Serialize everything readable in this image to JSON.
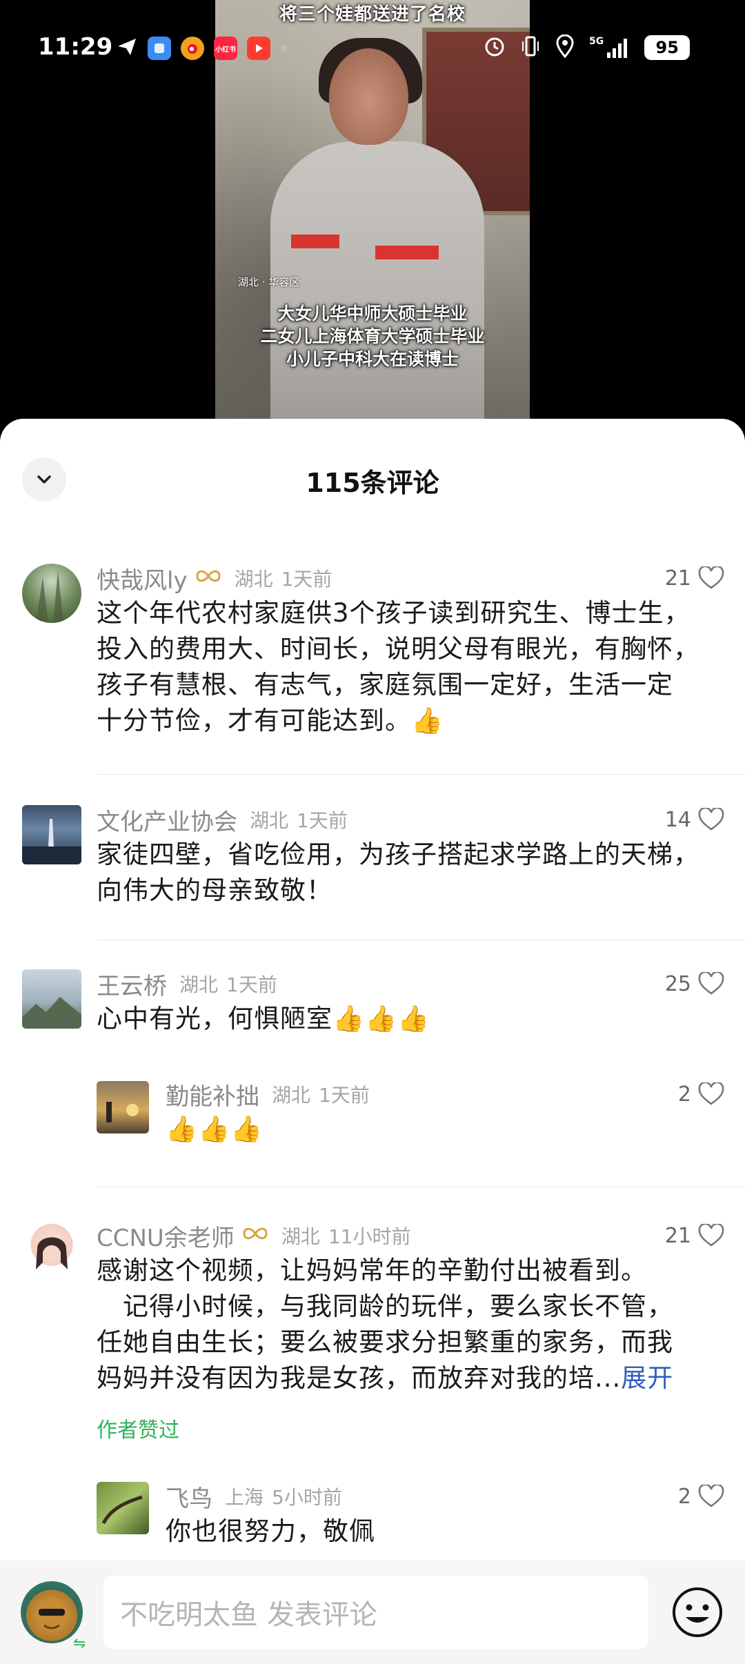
{
  "status_bar": {
    "time": "11:29",
    "left_icons": [
      "send-icon",
      "blue-app-icon",
      "weibo-icon",
      "xiaohongshu-icon",
      "video-app-icon",
      "dot-icon"
    ],
    "xhs_label": "小红书",
    "right_icons": [
      "alarm-icon",
      "vibrate-icon",
      "location-icon",
      "signal-5g-icon"
    ],
    "network": "5G",
    "battery": "95"
  },
  "video": {
    "title": "将三个娃都送进了名校",
    "location": "湖北 · 华容区",
    "subtitles": [
      "大女儿华中师大硕士毕业",
      "二女儿上海体育大学硕士毕业",
      "小儿子中科大在读博士"
    ]
  },
  "sheet": {
    "title": "115条评论"
  },
  "comments": [
    {
      "username": "快哉风ly",
      "badge": true,
      "location": "湖北",
      "time": "1天前",
      "likes": "21",
      "text_lines": [
        "这个年代农村家庭供3个孩子读到研究生、博士生，",
        "投入的费用大、时间长，说明父母有眼光，有胸怀，",
        "孩子有慧根、有志气，家庭氛围一定好，生活一定",
        "十分节俭，才有可能达到。👍"
      ]
    },
    {
      "username": "文化产业协会",
      "badge": false,
      "location": "湖北",
      "time": "1天前",
      "likes": "14",
      "text_lines": [
        "家徒四壁，省吃俭用，为孩子搭起求学路上的天梯，",
        "向伟大的母亲致敬！"
      ]
    },
    {
      "username": "王云桥",
      "badge": false,
      "location": "湖北",
      "time": "1天前",
      "likes": "25",
      "text_lines": [
        "心中有光，何惧陋室👍👍👍"
      ]
    },
    {
      "username": "勤能补拙",
      "badge": false,
      "location": "湖北",
      "time": "1天前",
      "likes": "2",
      "text_lines": [
        "👍👍👍"
      ]
    },
    {
      "username": "CCNU余老师",
      "badge": true,
      "location": "湖北",
      "time": "11小时前",
      "likes": "21",
      "text_lines": [
        "感谢这个视频，让妈妈常年的辛勤付出被看到。",
        "　记得小时候，与我同龄的玩伴，要么家长不管，",
        "任她自由生长；要么被要求分担繁重的家务，而我",
        "妈妈并没有因为我是女孩，而放弃对我的培..."
      ],
      "expand_label": "展开",
      "author_liked": "作者赞过"
    },
    {
      "username": "飞鸟",
      "badge": false,
      "location": "上海",
      "time": "5小时前",
      "likes": "2",
      "text_lines": [
        "你也很努力，敬佩"
      ]
    }
  ],
  "input": {
    "placeholder": "不吃明太鱼 发表评论",
    "swap_symbol": "⇋"
  },
  "colors": {
    "sheet_bg": "#ffffff",
    "accent_green": "#2db35d",
    "expand_blue": "#2f5fbf",
    "badge_gold": "#d8a442"
  }
}
